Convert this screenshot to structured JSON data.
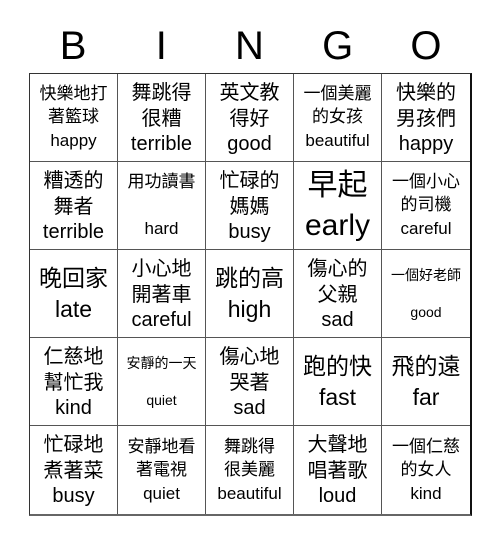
{
  "header": {
    "letters": [
      "B",
      "I",
      "N",
      "G",
      "O"
    ]
  },
  "cells": [
    {
      "zh": "快樂地打著籃球",
      "zh_lines": [
        "快樂地打",
        "著籃球"
      ],
      "en": "happy",
      "size": "medium"
    },
    {
      "zh": "舞跳得很糟",
      "zh_lines": [
        "舞跳得",
        "很糟"
      ],
      "en": "terrible",
      "size": "normal"
    },
    {
      "zh": "英文教得好",
      "zh_lines": [
        "英文教",
        "得好"
      ],
      "en": "good",
      "size": "normal"
    },
    {
      "zh": "一個美麗的女孩",
      "zh_lines": [
        "一個美麗",
        "的女孩"
      ],
      "en": "beautiful",
      "size": "medium"
    },
    {
      "zh": "快樂的男孩們",
      "zh_lines": [
        "快樂的",
        "男孩們"
      ],
      "en": "happy",
      "size": "normal"
    },
    {
      "zh": "糟透的舞者",
      "zh_lines": [
        "糟透的",
        "舞者"
      ],
      "en": "terrible",
      "size": "normal"
    },
    {
      "zh": "用功讀書",
      "zh_lines": [
        "用功讀書",
        ""
      ],
      "en": "hard",
      "size": "medium"
    },
    {
      "zh": "忙碌的媽媽",
      "zh_lines": [
        "忙碌的",
        "媽媽"
      ],
      "en": "busy",
      "size": "normal"
    },
    {
      "zh": "早起",
      "zh_lines": [
        "早起"
      ],
      "en": "early",
      "size": "xl"
    },
    {
      "zh": "一個小心的司機",
      "zh_lines": [
        "一個小心",
        "的司機"
      ],
      "en": "careful",
      "size": "medium"
    },
    {
      "zh": "晚回家",
      "zh_lines": [
        "晚回家"
      ],
      "en": "late",
      "size": "large"
    },
    {
      "zh": "小心地開著車",
      "zh_lines": [
        "小心地",
        "開著車"
      ],
      "en": "careful",
      "size": "normal"
    },
    {
      "zh": "跳的高",
      "zh_lines": [
        "跳的高"
      ],
      "en": "high",
      "size": "large"
    },
    {
      "zh": "傷心的父親",
      "zh_lines": [
        "傷心的",
        "父親"
      ],
      "en": "sad",
      "size": "normal"
    },
    {
      "zh": "一個好老師",
      "zh_lines": [
        "一個好老師"
      ],
      "en": "good",
      "size": "small-gap"
    },
    {
      "zh": "仁慈地幫忙我",
      "zh_lines": [
        "仁慈地",
        "幫忙我"
      ],
      "en": "kind",
      "size": "normal"
    },
    {
      "zh": "安靜的一天",
      "zh_lines": [
        "安靜的一天"
      ],
      "en": "quiet",
      "size": "small-gap"
    },
    {
      "zh": "傷心地哭著",
      "zh_lines": [
        "傷心地",
        "哭著"
      ],
      "en": "sad",
      "size": "normal"
    },
    {
      "zh": "跑的快",
      "zh_lines": [
        "跑的快"
      ],
      "en": "fast",
      "size": "large"
    },
    {
      "zh": "飛的遠",
      "zh_lines": [
        "飛的遠"
      ],
      "en": "far",
      "size": "large"
    },
    {
      "zh": "忙碌地煮著菜",
      "zh_lines": [
        "忙碌地",
        "煮著菜"
      ],
      "en": "busy",
      "size": "normal"
    },
    {
      "zh": "安靜地看著電視",
      "zh_lines": [
        "安靜地看",
        "著電視"
      ],
      "en": "quiet",
      "size": "medium"
    },
    {
      "zh": "舞跳得很美麗",
      "zh_lines": [
        "舞跳得",
        "很美麗"
      ],
      "en": "beautiful",
      "size": "medium"
    },
    {
      "zh": "大聲地唱著歌",
      "zh_lines": [
        "大聲地",
        "唱著歌"
      ],
      "en": "loud",
      "size": "normal"
    },
    {
      "zh": "一個仁慈的女人",
      "zh_lines": [
        "一個仁慈",
        "的女人"
      ],
      "en": "kind",
      "size": "medium"
    }
  ]
}
